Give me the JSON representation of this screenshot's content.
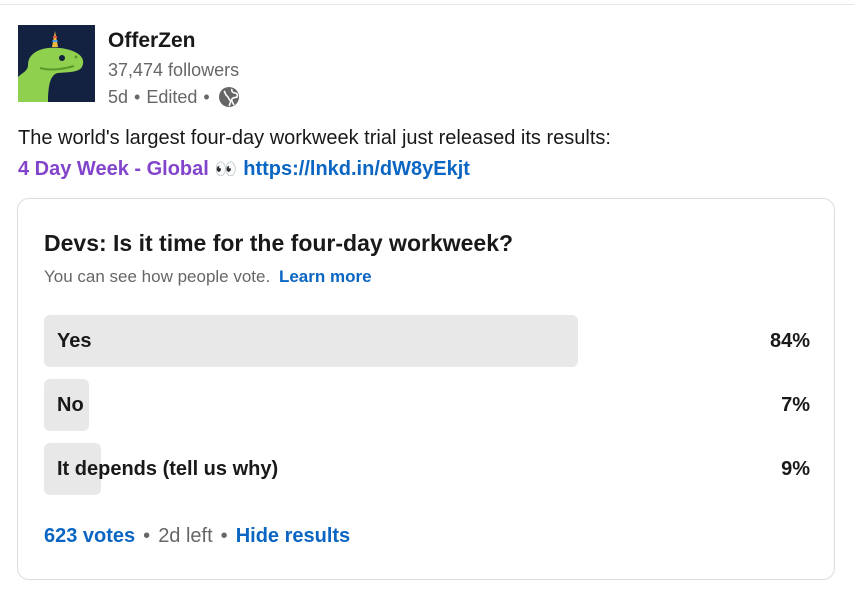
{
  "post": {
    "author": {
      "name": "OfferZen",
      "followers": "37,474 followers",
      "age": "5d",
      "edited": "Edited",
      "visibility_icon": "globe-icon"
    },
    "text": "The world's largest four-day workweek trial just released its results:",
    "hashtag": "4 Day Week - Global",
    "emoji": "👀",
    "link": "https://lnkd.in/dW8yEkjt"
  },
  "poll": {
    "question": "Devs: Is it time for the four-day workweek?",
    "subtitle": "You can see how people vote.",
    "learn_more": "Learn more",
    "options": [
      {
        "label": "Yes",
        "percent_text": "84%",
        "percent": 84
      },
      {
        "label": "No",
        "percent_text": "7%",
        "percent": 7
      },
      {
        "label": "It depends (tell us why)",
        "percent_text": "9%",
        "percent": 9
      }
    ],
    "votes": "623 votes",
    "time_left": "2d left",
    "hide_results": "Hide results"
  },
  "colors": {
    "link_blue": "#0a66c2",
    "hashtag_purple": "#8344cc",
    "bar_fill": "#e8e8e8"
  }
}
